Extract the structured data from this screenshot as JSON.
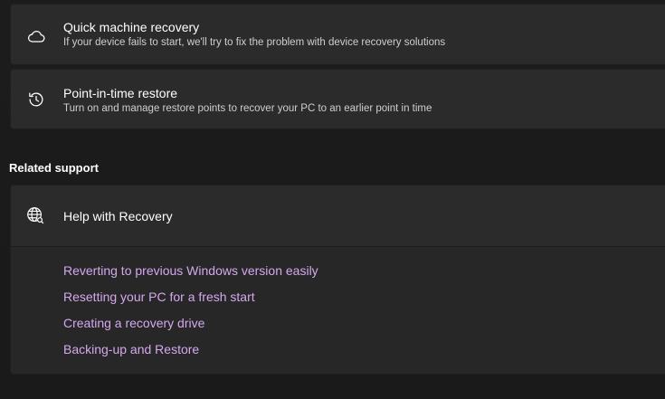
{
  "recovery_options": {
    "quick_machine_recovery": {
      "title": "Quick machine recovery",
      "description": "If your device fails to start, we'll try to fix the problem with device recovery solutions",
      "icon": "cloud-icon"
    },
    "point_in_time_restore": {
      "title": "Point-in-time restore",
      "description": "Turn on and manage restore points to recover your PC to an earlier point in time",
      "icon": "history-icon"
    }
  },
  "related_support": {
    "header": "Related support",
    "help_card": {
      "title": "Help with Recovery",
      "icon": "globe-icon",
      "links": [
        "Reverting to previous Windows version easily",
        "Resetting your PC for a fresh start",
        "Creating a recovery drive",
        "Backing-up and Restore"
      ]
    }
  },
  "colors": {
    "background": "#1c1c1c",
    "card": "#2b2b2b",
    "link": "#d4a8f0"
  }
}
